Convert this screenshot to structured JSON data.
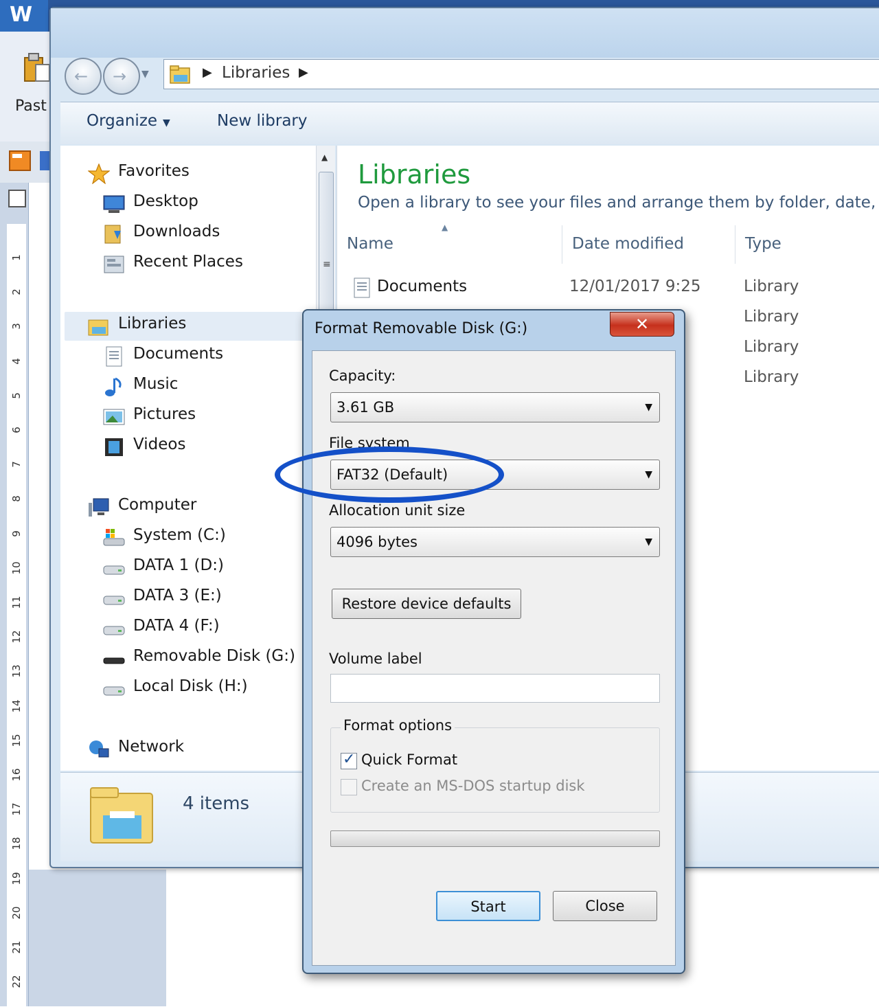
{
  "word": {
    "logo_letter": "W",
    "paste_label": "Past",
    "ruler_numbers": [
      "1",
      "2",
      "3",
      "4",
      "5",
      "6",
      "7",
      "8",
      "9",
      "10",
      "11",
      "12",
      "13",
      "14",
      "15",
      "16",
      "17",
      "18",
      "19",
      "20",
      "21",
      "22"
    ]
  },
  "explorer": {
    "address": {
      "segments": [
        "Libraries"
      ]
    },
    "commandbar": {
      "organize": "Organize",
      "new_library": "New library"
    },
    "navigation": {
      "favorites": {
        "label": "Favorites",
        "items": [
          "Desktop",
          "Downloads",
          "Recent Places"
        ]
      },
      "libraries": {
        "label": "Libraries",
        "items": [
          "Documents",
          "Music",
          "Pictures",
          "Videos"
        ]
      },
      "computer": {
        "label": "Computer",
        "items": [
          "System (C:)",
          "DATA 1 (D:)",
          "DATA 3 (E:)",
          "DATA 4 (F:)",
          "Removable Disk (G:)",
          "Local Disk (H:)"
        ]
      },
      "network": {
        "label": "Network"
      }
    },
    "content": {
      "title": "Libraries",
      "subtitle": "Open a library to see your files and arrange them by folder, date, and",
      "columns": {
        "name": "Name",
        "date": "Date modified",
        "type": "Type"
      },
      "rows": [
        {
          "name": "Documents",
          "date": "12/01/2017 9:25",
          "type": "Library"
        },
        {
          "name": "",
          "date": "",
          "type": "Library"
        },
        {
          "name": "",
          "date": "",
          "type": "Library"
        },
        {
          "name": "",
          "date": "",
          "type": "Library"
        }
      ]
    },
    "details": {
      "count": "4 items"
    }
  },
  "format_dialog": {
    "title": "Format Removable Disk (G:)",
    "close_glyph": "✕",
    "capacity_label": "Capacity:",
    "capacity_value": "3.61 GB",
    "filesystem_label": "File system",
    "filesystem_value": "FAT32 (Default)",
    "allocation_label": "Allocation unit size",
    "allocation_value": "4096 bytes",
    "restore_button": "Restore device defaults",
    "volume_label": "Volume label",
    "volume_value": "",
    "options_label": "Format options",
    "quick_format_label": "Quick Format",
    "quick_format_checked": true,
    "msdos_label": "Create an MS-DOS startup disk",
    "msdos_checked": false,
    "progress": 0,
    "start_button": "Start",
    "close_button": "Close"
  },
  "annotation": {
    "highlight_color": "#1450c8"
  }
}
